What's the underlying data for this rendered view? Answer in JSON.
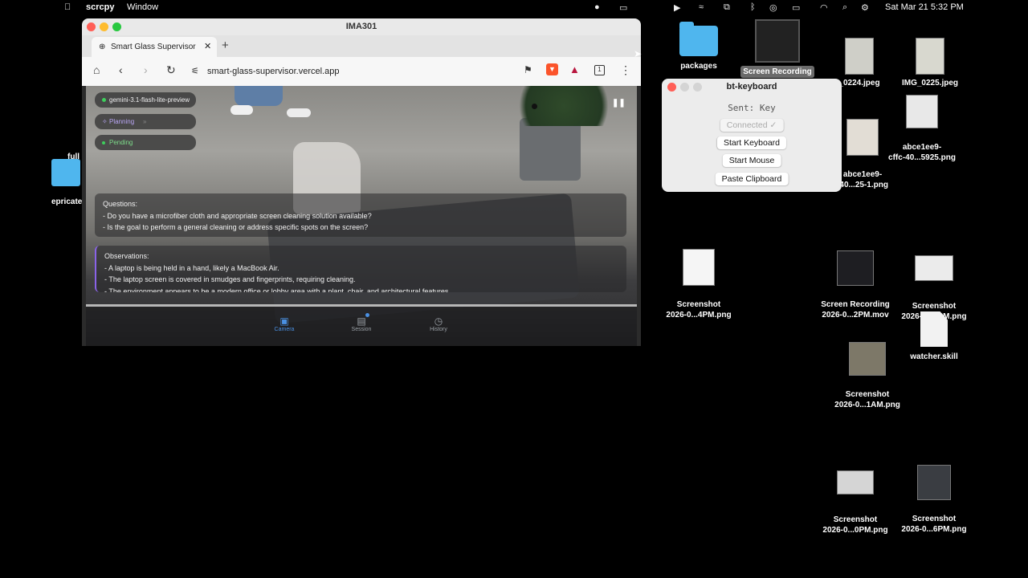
{
  "menubar": {
    "app_name": "scrcpy",
    "menu_window": "Window",
    "datetime": "Sat Mar 21  5:32 PM"
  },
  "desktop": {
    "icons": [
      {
        "label": "packages"
      },
      {
        "label": "Screen Recording"
      },
      {
        "label": "_0224.jpeg"
      },
      {
        "label": "IMG_0225.jpeg"
      },
      {
        "label": "abce1ee9-\ncffc-40...5925.png"
      },
      {
        "label": "abce1ee9-\n-40...25-1.png"
      },
      {
        "label": "Screenshot\n2026-0...4PM.png"
      },
      {
        "label": "Screen Recording\n2026-0...2PM.mov"
      },
      {
        "label": "Screenshot\n2026-0...1PM.png"
      },
      {
        "label": "Screenshot\n2026-0...1AM.png"
      },
      {
        "label": "watcher.skill"
      },
      {
        "label": "Screenshot\n2026-0...0PM.png"
      },
      {
        "label": "Screenshot\n2026-0...6PM.png"
      },
      {
        "label_top": "full",
        "label_bottom": "epricate"
      }
    ]
  },
  "window": {
    "title": "IMA301",
    "tab_title": "Smart Glass Supervisor",
    "url": "smart-glass-supervisor.vercel.app",
    "tab_count": "1"
  },
  "app": {
    "model": "gemini-3.1-flash-lite-preview",
    "planning": "Planning",
    "pending": "Pending",
    "questions_title": "Questions:",
    "questions": [
      "- Do you have a microfiber cloth and appropriate screen cleaning solution available?",
      "- Is the goal to perform a general cleaning or address specific spots on the screen?"
    ],
    "observations_title": "Observations:",
    "observations": [
      "- A laptop is being held in a hand, likely a MacBook Air.",
      "- The laptop screen is covered in smudges and fingerprints, requiring cleaning.",
      "- The environment appears to be a modern office or lobby area with a plant, chair, and architectural features."
    ],
    "nav": {
      "camera": "Camera",
      "session": "Session",
      "history": "History"
    }
  },
  "bt_keyboard": {
    "title": "bt-keyboard",
    "sent": "Sent: Key",
    "connected": "Connected ✓",
    "start_keyboard": "Start Keyboard",
    "start_mouse": "Start Mouse",
    "paste_clipboard": "Paste Clipboard"
  }
}
